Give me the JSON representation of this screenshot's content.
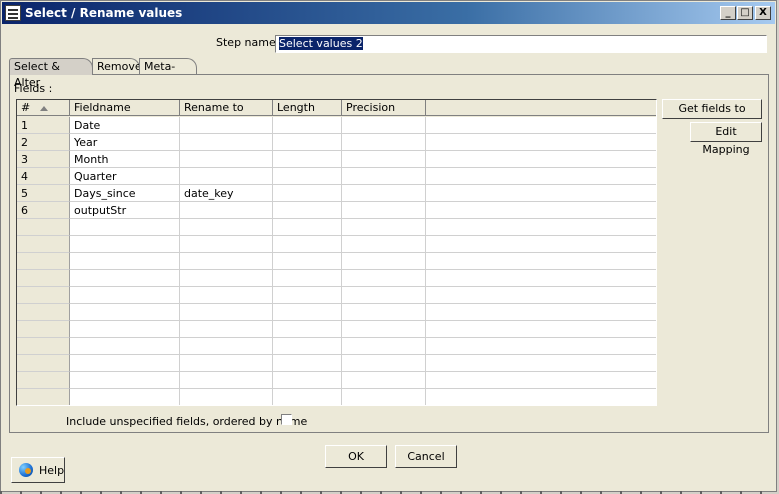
{
  "window": {
    "title": "Select / Rename values",
    "controls": {
      "minimize": "_",
      "maximize": "□",
      "close": "X"
    }
  },
  "step": {
    "label": "Step name",
    "value": "Select values 2"
  },
  "tabs": [
    {
      "label": "Select & Alter",
      "active": true
    },
    {
      "label": "Remove",
      "active": false
    },
    {
      "label": "Meta-data",
      "active": false
    }
  ],
  "fields": {
    "label": "Fields :",
    "columns": [
      "#",
      "Fieldname",
      "Rename to",
      "Length",
      "Precision",
      ""
    ],
    "rows": [
      [
        "1",
        "Date",
        "",
        "",
        ""
      ],
      [
        "2",
        "Year",
        "",
        "",
        ""
      ],
      [
        "3",
        "Month",
        "",
        "",
        ""
      ],
      [
        "4",
        "Quarter",
        "",
        "",
        ""
      ],
      [
        "5",
        "Days_since",
        "date_key",
        "",
        ""
      ],
      [
        "6",
        "outputStr",
        "",
        "",
        ""
      ],
      [
        "",
        "",
        "",
        "",
        ""
      ],
      [
        "",
        "",
        "",
        "",
        ""
      ],
      [
        "",
        "",
        "",
        "",
        ""
      ],
      [
        "",
        "",
        "",
        "",
        ""
      ],
      [
        "",
        "",
        "",
        "",
        ""
      ],
      [
        "",
        "",
        "",
        "",
        ""
      ],
      [
        "",
        "",
        "",
        "",
        ""
      ],
      [
        "",
        "",
        "",
        "",
        ""
      ],
      [
        "",
        "",
        "",
        "",
        ""
      ],
      [
        "",
        "",
        "",
        "",
        ""
      ],
      [
        "",
        "",
        "",
        "",
        ""
      ]
    ]
  },
  "buttons": {
    "get_fields": "Get fields to select",
    "edit_mapping": "Edit Mapping",
    "ok": "OK",
    "cancel": "Cancel",
    "help": "Help"
  },
  "include_unspecified": {
    "label": "Include unspecified fields, ordered by name",
    "checked": false
  }
}
